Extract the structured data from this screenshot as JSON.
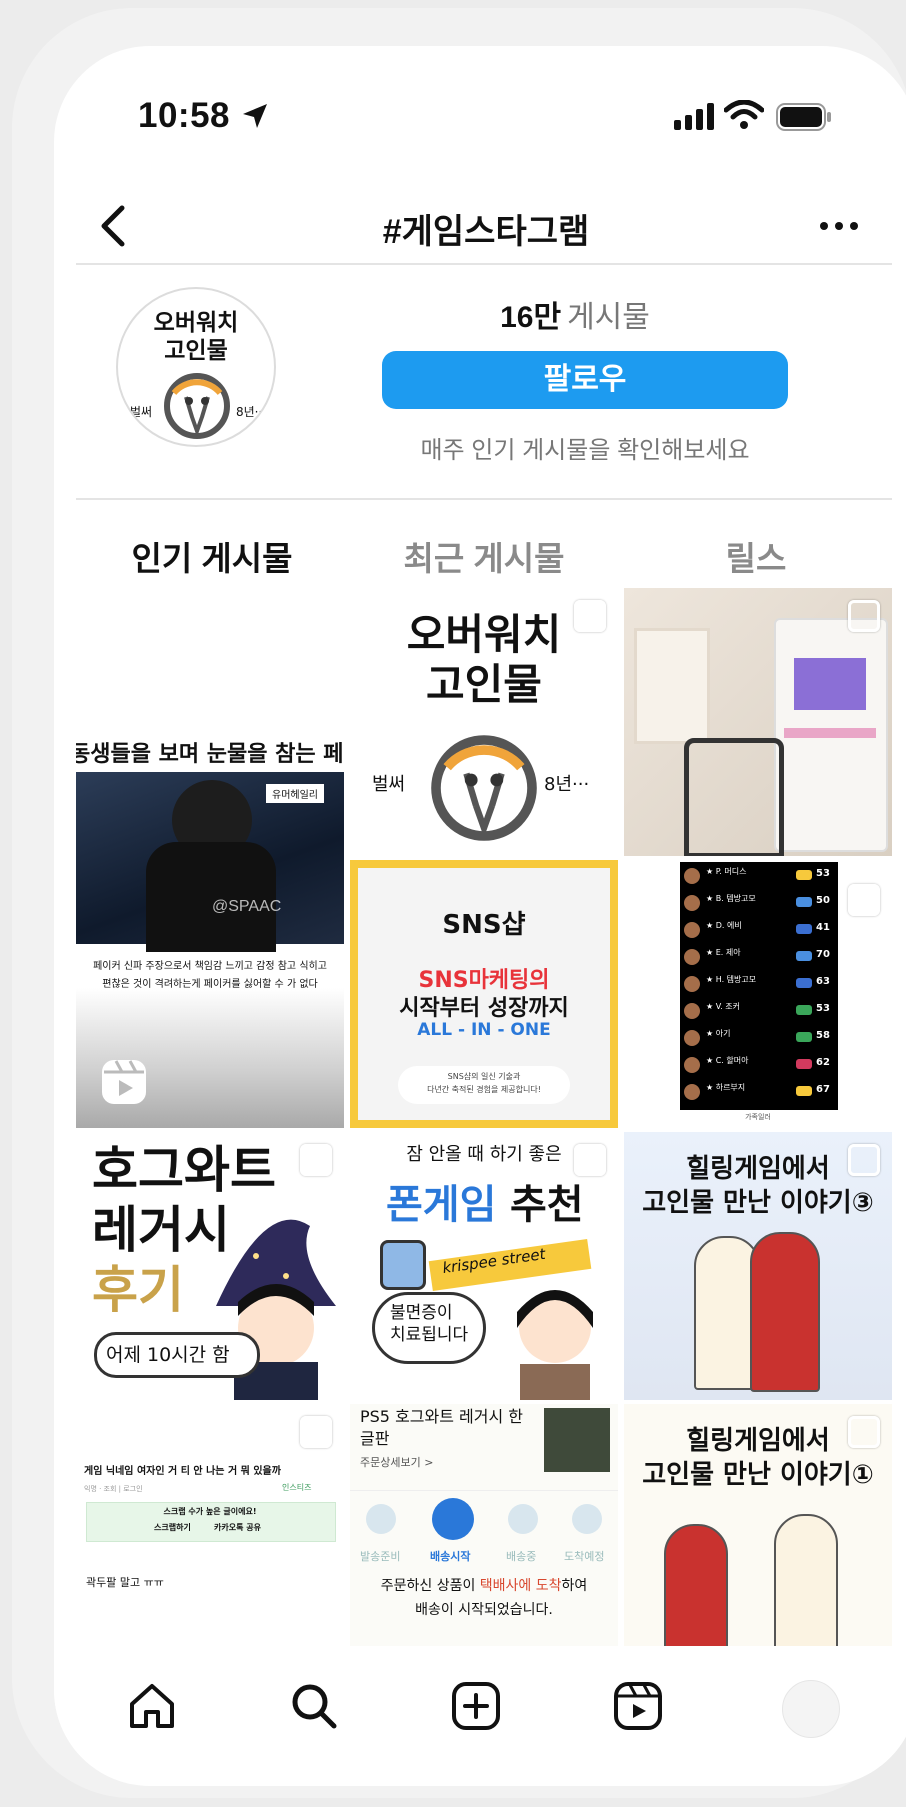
{
  "status_bar": {
    "time": "10:58"
  },
  "header": {
    "title": "#게임스타그램"
  },
  "profile": {
    "avatar_text_line1": "오버워치",
    "avatar_text_line2": "고인물",
    "avatar_left": "벌써",
    "avatar_right": "8년···",
    "post_count": "16만",
    "post_label": "게시물",
    "follow_label": "팔로우",
    "hint": "매주 인기 게시물을 확인해보세요"
  },
  "tabs": [
    {
      "label": "인기 게시물",
      "active": true
    },
    {
      "label": "최근 게시물",
      "active": false
    },
    {
      "label": "릴스",
      "active": false
    }
  ],
  "posts": {
    "p1": {
      "caption": "동생들을 보며 눈물을 참는 페이커",
      "tag": "유머헤일리",
      "watermark": "@SPAAC",
      "subtext1": "페이커 신파 주장으로서 책임감 느끼고 감정 참고 식히고",
      "subtext2": "편찮은 것이 격려하는게 페이커를 싫어할 수 가 없다"
    },
    "p2": {
      "line1": "오버워치",
      "line2": "고인물",
      "left": "벌써",
      "right": "8년···"
    },
    "p4": {
      "brand": "SNS샵",
      "line1": "SNS마케팅의",
      "line2": "시작부터 성장까지",
      "line3": "ALL - IN - ONE",
      "note1": "SNS샵의 일신 기술과",
      "note2": "다년간 축적된 경험을 제공합니다!"
    },
    "p5": {
      "rows": [
        {
          "name": "P. 머디스",
          "score": "53"
        },
        {
          "name": "B. 템방고모",
          "score": "50"
        },
        {
          "name": "D. 에비",
          "score": "41"
        },
        {
          "name": "E. 제아",
          "score": "70"
        },
        {
          "name": "H. 템방고모",
          "score": "63"
        },
        {
          "name": "V. 조커",
          "score": "53"
        },
        {
          "name": "아기",
          "score": "58"
        },
        {
          "name": "C. 할머아",
          "score": "62"
        },
        {
          "name": "하르부지",
          "score": "67"
        }
      ],
      "footer": "가족일러"
    },
    "p6": {
      "line1": "호그와트",
      "line2": "레거시",
      "line3": "후기",
      "bubble": "어제 10시간 함"
    },
    "p7": {
      "top": "잠 안올 때 하기 좋은",
      "title1": "폰게임",
      "title2": "추천",
      "ribbon": "krispee street",
      "bubble1": "불면증이",
      "bubble2": "치료됩니다"
    },
    "p8": {
      "line1": "힐링게임에서",
      "line2": "고인물 만난 이야기③"
    },
    "p9": {
      "headline": "게임 닉네임 여자인 거 티 안 나는 거 뭐 있을까",
      "meta": "익명 · 조회 | 로그인",
      "source": "인스티즈",
      "box1": "스크랩 수가 높은 글이에요!",
      "box2a": "스크랩하기",
      "box2b": "카카오톡 공유",
      "comment": "곽두팔 말고 ㅠㅠ"
    },
    "p10": {
      "title": "PS5 호그와트 레거시 한 글판",
      "link": "주문상세보기 >",
      "steps": [
        "발송준비",
        "배송시작",
        "배송중",
        "도착예정"
      ],
      "msg1a": "주문하신 상품이 ",
      "msg1b": "택배사에 도착",
      "msg1c": "하여",
      "msg2": "배송이 시작되었습니다."
    },
    "p11": {
      "line1": "힐링게임에서",
      "line2": "고인물 만난 이야기①"
    }
  },
  "colors": {
    "accent": "#1d9bf0",
    "sns_red": "#e8333a",
    "sns_blue": "#2a78d9"
  }
}
